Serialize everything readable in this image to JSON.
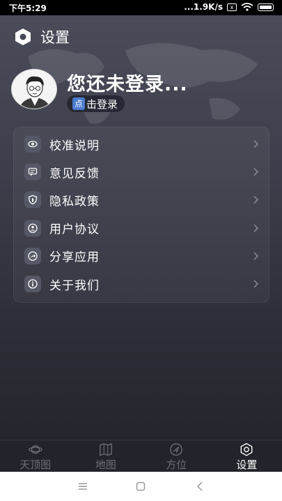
{
  "status_bar": {
    "time": "下午5:29",
    "speed": "...1.9K/s",
    "x_badge": "x"
  },
  "header": {
    "title": "设置"
  },
  "profile": {
    "login_title": "您还未登录...",
    "login_button": "击登录",
    "login_badge": "点"
  },
  "menu": {
    "items": [
      {
        "label": "校准说明",
        "icon": "calibrate-icon"
      },
      {
        "label": "意见反馈",
        "icon": "feedback-icon"
      },
      {
        "label": "隐私政策",
        "icon": "privacy-icon"
      },
      {
        "label": "用户协议",
        "icon": "user-agreement-icon"
      },
      {
        "label": "分享应用",
        "icon": "share-icon"
      },
      {
        "label": "关于我们",
        "icon": "about-icon"
      }
    ]
  },
  "tabs": [
    {
      "label": "天顶图",
      "icon": "planet-icon",
      "active": false
    },
    {
      "label": "地图",
      "icon": "map-icon",
      "active": false
    },
    {
      "label": "方位",
      "icon": "compass-icon",
      "active": false
    },
    {
      "label": "设置",
      "icon": "settings-icon",
      "active": true
    }
  ],
  "colors": {
    "active_tab": "#ffffff",
    "inactive_tab": "#6b6d78",
    "login_badge": "#4a7bd0"
  }
}
